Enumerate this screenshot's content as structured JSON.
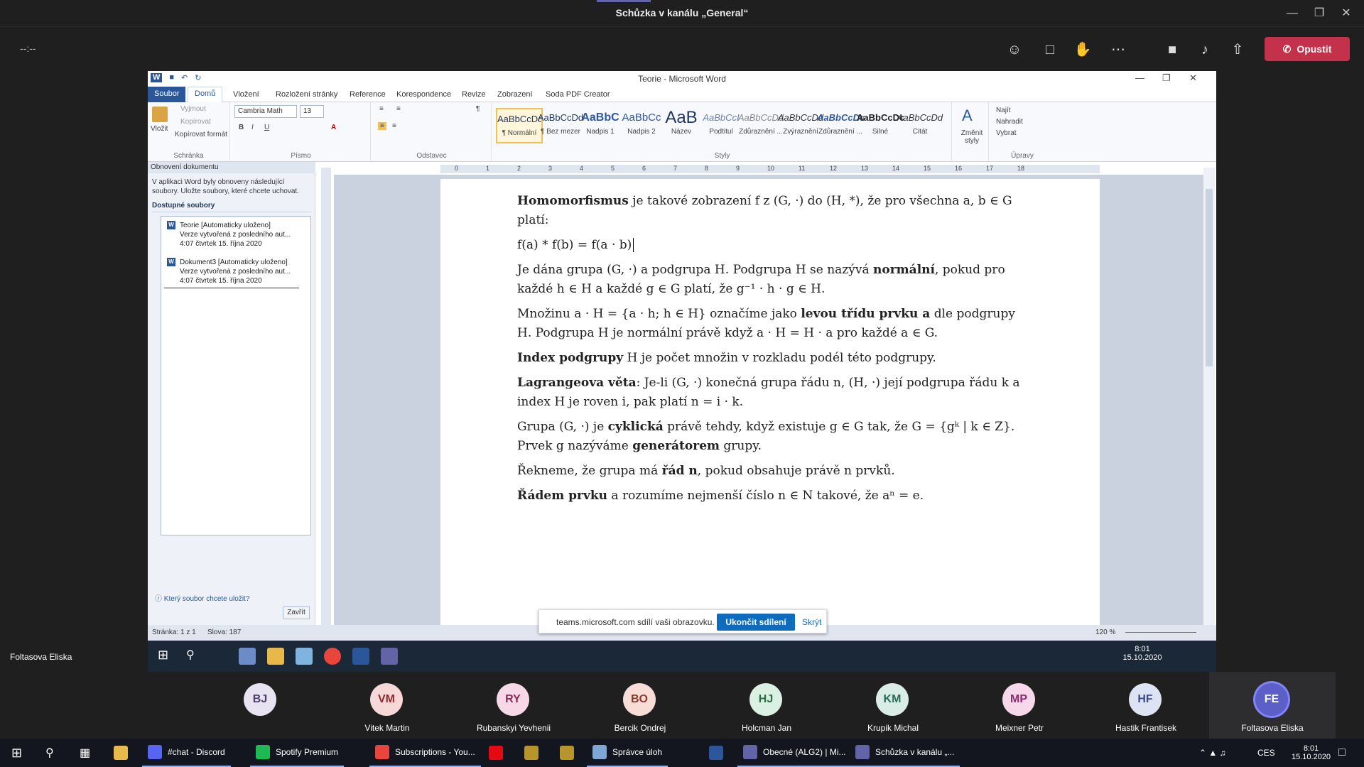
{
  "teams": {
    "title": "Schůzka v kanálu „General“",
    "timer": "--:--",
    "leave_label": "Opustit",
    "presenter": "Foltasova Eliska",
    "accent": "#6264a7",
    "leave_color": "#c4314b"
  },
  "word": {
    "title": "Teorie - Microsoft Word",
    "tabs": [
      "Soubor",
      "Domů",
      "Vložení",
      "Rozložení stránky",
      "Reference",
      "Korespondence",
      "Revize",
      "Zobrazení",
      "Soda PDF Creator"
    ],
    "clipboard": {
      "paste": "Vložit",
      "cut": "Vyjmout",
      "copy": "Kopírovat",
      "format": "Kopírovat formát",
      "label": "Schránka"
    },
    "font": {
      "name": "Cambria Math",
      "size": "13",
      "label": "Písmo"
    },
    "paragraph_label": "Odstavec",
    "styles": [
      {
        "preview": "AaBbCcDd",
        "name": "¶ Normální"
      },
      {
        "preview": "AaBbCcDd",
        "name": "¶ Bez mezer"
      },
      {
        "preview": "AaBbC",
        "name": "Nadpis 1"
      },
      {
        "preview": "AaBbCc",
        "name": "Nadpis 2"
      },
      {
        "preview": "AaB",
        "name": "Název"
      },
      {
        "preview": "AaBbCcI",
        "name": "Podtitul"
      },
      {
        "preview": "AaBbCcDd",
        "name": "Zdůraznění ..."
      },
      {
        "preview": "AaBbCcDd",
        "name": "Zvýraznění"
      },
      {
        "preview": "AaBbCcDd",
        "name": "Zdůraznění ..."
      },
      {
        "preview": "AaBbCcDc",
        "name": "Silné"
      },
      {
        "preview": "AaBbCcDd",
        "name": "Citát"
      }
    ],
    "change_styles": "Změnit styly",
    "styles_label": "Styly",
    "editing": {
      "find": "Najít",
      "replace": "Nahradit",
      "select": "Vybrat",
      "label": "Úpravy"
    },
    "status": {
      "page": "Stránka: 1 z 1",
      "words": "Slova: 187",
      "zoom": "120 %"
    }
  },
  "recovery": {
    "header": "Obnovení dokumentu",
    "description": "V aplikaci Word byly obnoveny následující soubory. Uložte soubory, které chcete uchovat.",
    "section": "Dostupné soubory",
    "files": [
      {
        "name": "Teorie  [Automaticky uloženo]",
        "line2": "Verze vytvořená z posledního aut...",
        "line3": "4:07 čtvrtek 15. října 2020"
      },
      {
        "name": "Dokument3  [Automaticky uloženo]",
        "line2": "Verze vytvořená z posledního aut...",
        "line3": "4:07 čtvrtek 15. října 2020"
      }
    ],
    "help": "Který soubor chcete uložit?",
    "close": "Zavřít"
  },
  "doc": {
    "p1_b": "Homomorfismus",
    "p1": " je takové zobrazení f z (G, ·) do (H, *), že pro všechna a, b ∈ G platí:",
    "p2": "f(a) * f(b) = f(a · b)",
    "p3a": "Je dána grupa (G, ·) a podgrupa H. Podgrupa H se nazývá ",
    "p3_b": "normální",
    "p3b": ", pokud pro každé h ∈ H a každé g ∈ G platí, že g⁻¹ · h · g ∈ H.",
    "p4a": "Množinu a · H = {a · h; h ∈ H} označíme jako ",
    "p4_b": "levou třídu prvku a",
    "p4b": " dle podgrupy H. Podgrupa H je normální právě když a · H = H · a pro každé a ∈ G.",
    "p5_b": "Index podgrupy",
    "p5": " H je počet množin v rozkladu podél této podgrupy.",
    "p6_b": "Lagrangeova věta",
    "p6": ": Je-li (G, ·) konečná grupa řádu n, (H, ·) její podgrupa řádu k a index H je roven i, pak platí n = i · k.",
    "p7a": "Grupa (G, ·) je ",
    "p7_b": "cyklická",
    "p7b": " právě tehdy, když existuje g ∈ G tak, že G = {gᵏ | k ∈ Z}. Prvek g nazýváme ",
    "p7_b2": "generátorem",
    "p7c": " grupy.",
    "p8a": "Řekneme, že grupa má ",
    "p8_b": "řád n",
    "p8b": ", pokud obsahuje právě n prvků.",
    "p9_b": "Řádem prvku",
    "p9": " a rozumíme nejmenší číslo n ∈ N takové, že aⁿ = e."
  },
  "banner": {
    "msg": "teams.microsoft.com sdílí vaši obrazovku.",
    "stop": "Ukončit sdílení",
    "hide": "Skrýt"
  },
  "embedded_clock": {
    "time": "8:01",
    "date": "15.10.2020"
  },
  "participants": [
    {
      "initials": "BJ",
      "name": "",
      "color": "#e8e3f0",
      "fg": "#4a3f6b"
    },
    {
      "initials": "VM",
      "name": "Vitek Martin",
      "color": "#f6d8d8",
      "fg": "#8a2b2b"
    },
    {
      "initials": "RY",
      "name": "Rubanskyi Yevhenii",
      "color": "#f6d8e6",
      "fg": "#8a2b5a"
    },
    {
      "initials": "BO",
      "name": "Bercik Ondrej",
      "color": "#f8dcd6",
      "fg": "#8a3b2b"
    },
    {
      "initials": "HJ",
      "name": "Holcman Jan",
      "color": "#d9f0e3",
      "fg": "#2b6b45"
    },
    {
      "initials": "KM",
      "name": "Krupik Michal",
      "color": "#d9ece6",
      "fg": "#2b6b5a"
    },
    {
      "initials": "MP",
      "name": "Meixner Petr",
      "color": "#f6d8ea",
      "fg": "#8a2b6b"
    },
    {
      "initials": "HF",
      "name": "Hastik Frantisek",
      "color": "#dde3f3",
      "fg": "#3b4a8a"
    },
    {
      "initials": "FE",
      "name": "Foltasova Eliska",
      "color": "#5b5fc7",
      "fg": "#ffffff"
    }
  ],
  "taskbar": {
    "items": [
      {
        "label": "#chat - Discord",
        "color": "#5865f2"
      },
      {
        "label": "Spotify Premium",
        "color": "#1db954"
      },
      {
        "label": "Subscriptions - You...",
        "color": "#e8453c"
      },
      {
        "label": "",
        "color": "#e50914"
      },
      {
        "label": "",
        "color": "#b7952c"
      },
      {
        "label": "",
        "color": "#b7952c"
      },
      {
        "label": "Správce úloh",
        "color": "#7fa7d6"
      },
      {
        "label": "",
        "color": "#2b579a"
      },
      {
        "label": "Obecné (ALG2) | Mi...",
        "color": "#6264a7"
      },
      {
        "label": "Schůzka v kanálu „...",
        "color": "#6264a7"
      }
    ],
    "lang": "CES",
    "time": "8:01",
    "date": "15.10.2020"
  }
}
